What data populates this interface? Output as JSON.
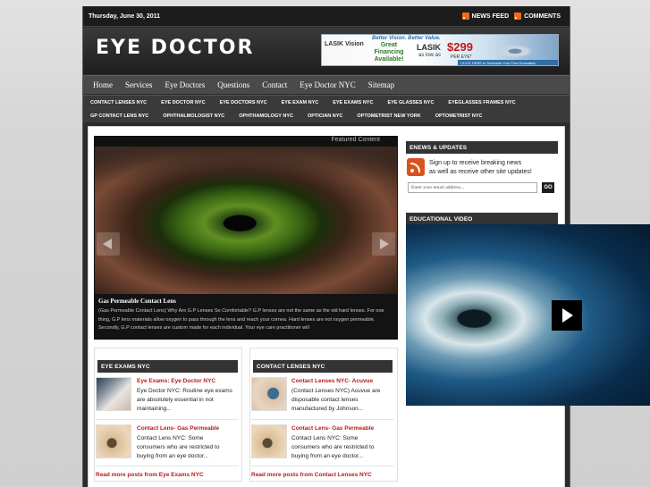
{
  "topbar": {
    "date": "Thursday, June 30, 2011",
    "news_feed": "NEWS FEED",
    "comments": "COMMENTS"
  },
  "header": {
    "site_title": "EYE DOCTOR",
    "ad": {
      "logo": "LASIK Vision",
      "tagline": "Better Vision. Better Value.",
      "financing": "Great Financing Available!",
      "lasik": "LASIK",
      "price": "$299",
      "as_low_as": "as low as",
      "per_eye": "PER EYE*",
      "cta": "CLICK HERE to Schedule Your Free Evaluation"
    }
  },
  "nav": {
    "items": [
      "Home",
      "Services",
      "Eye Doctors",
      "Questions",
      "Contact",
      "Eye Doctor NYC",
      "Sitemap"
    ]
  },
  "subnav": {
    "row1": [
      "CONTACT LENSES NYC",
      "EYE DOCTOR NYC",
      "EYE DOCTORS NYC",
      "EYE EXAM NYC",
      "EYE EXAMS NYC",
      "EYE GLASSES NYC",
      "EYEGLASSES FRAMES NYC"
    ],
    "row2": [
      "GP CONTACT LENS NYC",
      "OPHTHALMOLOGIST NYC",
      "OPHTHAMOLOGY NYC",
      "OPTICIAN NYC",
      "OPTOMETRIST NEW YORK",
      "OPTOMETRIST NYC"
    ]
  },
  "featured": {
    "label": "Featured Content",
    "title": "Gas Permeable Contact Lens",
    "text": "(Gas Permeable Contact Lens) Why Are G.P Lenses So Comfortable? G.P lenses are not the same as the old hard lenses. For one thing, G.P lens materials allow oxygen to pass through the lens and reach your cornea. Hard lenses are not oxygen permeable. Secondly, G.P contact lenses are custom made for each individual. Your eye care practitioner will"
  },
  "eye_exams": {
    "heading": "EYE EXAMS NYC",
    "posts": [
      {
        "title": "Eye Exams: Eye Doctor NYC",
        "text": [
          "Eye Doctor NYC: Routine eye exams",
          "are absolutely essential in not",
          "maintaining..."
        ]
      },
      {
        "title": "Contact Lens- Gas Permeable",
        "text": [
          "Contact Lens NYC: Some",
          "consumers who are restricted to",
          "buying from an eye doctor..."
        ]
      }
    ],
    "read_more": "Read more posts from Eye Exams NYC"
  },
  "contact_lenses": {
    "heading": "CONTACT LENSES NYC",
    "posts": [
      {
        "title": "Contact Lenses NYC- Acuvue",
        "text": [
          "(Contact Lenses NYC) Acuvue are",
          "disposable contact lenses",
          "manufactured by Johnson..."
        ]
      },
      {
        "title": "Contact Lens- Gas Permeable",
        "text": [
          "Contact Lens NYC: Some",
          "consumers who are restricted to",
          "buying from an eye doctor..."
        ]
      }
    ],
    "read_more": "Read more posts from Contact Lenses NYC"
  },
  "enews": {
    "heading": "ENEWS & UPDATES",
    "line1": "Sign up to receive breaking news",
    "line2": "as well as receive other site updates!",
    "email_placeholder": "Enter your email address...",
    "go": "GO"
  },
  "video": {
    "heading": "EDUCATIONAL VIDEO"
  },
  "colors": {
    "accent_red": "#b31c1c",
    "header_dark": "#1c1c1c",
    "nav": "#4a4a4a"
  }
}
